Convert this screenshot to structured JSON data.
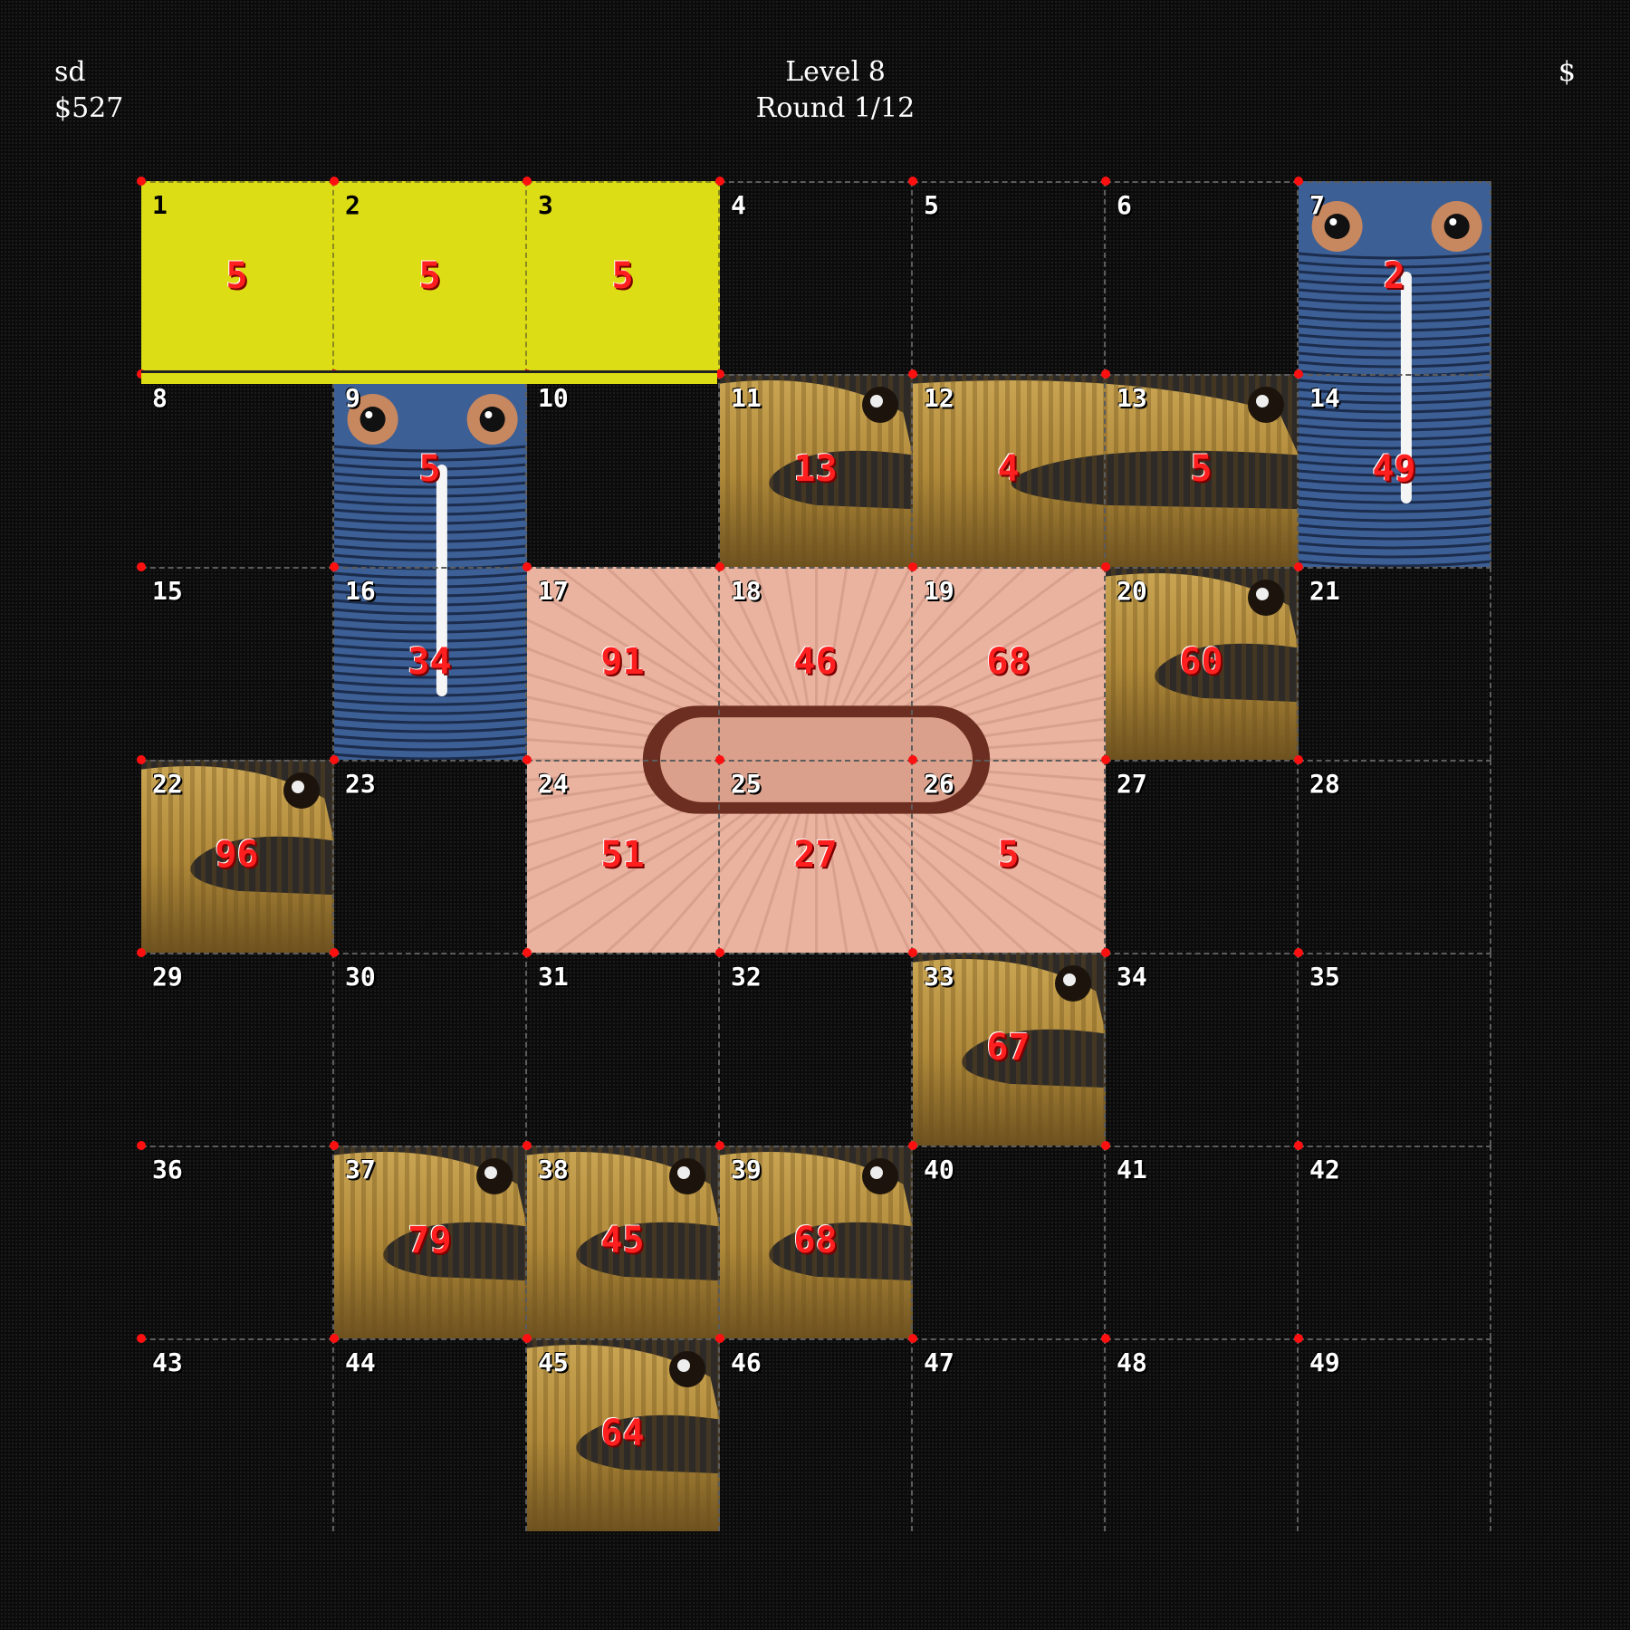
{
  "hud": {
    "player_name": "sd",
    "money": "$527",
    "level": "Level 8",
    "round": "Round 1/12",
    "currency_symbol": "$"
  },
  "board": {
    "cols": 7,
    "rows": 7,
    "cells": [
      {
        "n": "1",
        "v": "5",
        "kind": "yellow"
      },
      {
        "n": "2",
        "v": "5",
        "kind": "yellow"
      },
      {
        "n": "3",
        "v": "5",
        "kind": "yellow"
      },
      {
        "n": "4",
        "v": "",
        "kind": "empty"
      },
      {
        "n": "5",
        "v": "",
        "kind": "empty"
      },
      {
        "n": "6",
        "v": "",
        "kind": "empty"
      },
      {
        "n": "7",
        "v": "2",
        "kind": "blue"
      },
      {
        "n": "8",
        "v": "",
        "kind": "empty"
      },
      {
        "n": "9",
        "v": "5",
        "kind": "blue"
      },
      {
        "n": "10",
        "v": "",
        "kind": "empty"
      },
      {
        "n": "11",
        "v": "13",
        "kind": "worm"
      },
      {
        "n": "12",
        "v": "4",
        "kind": "worm"
      },
      {
        "n": "13",
        "v": "5",
        "kind": "worm"
      },
      {
        "n": "14",
        "v": "49",
        "kind": "blue"
      },
      {
        "n": "15",
        "v": "",
        "kind": "empty"
      },
      {
        "n": "16",
        "v": "34",
        "kind": "blue"
      },
      {
        "n": "17",
        "v": "91",
        "kind": "pink"
      },
      {
        "n": "18",
        "v": "46",
        "kind": "pink"
      },
      {
        "n": "19",
        "v": "68",
        "kind": "pink"
      },
      {
        "n": "20",
        "v": "60",
        "kind": "worm"
      },
      {
        "n": "21",
        "v": "",
        "kind": "empty"
      },
      {
        "n": "22",
        "v": "96",
        "kind": "worm"
      },
      {
        "n": "23",
        "v": "",
        "kind": "empty"
      },
      {
        "n": "24",
        "v": "51",
        "kind": "pink"
      },
      {
        "n": "25",
        "v": "27",
        "kind": "pink"
      },
      {
        "n": "26",
        "v": "5",
        "kind": "pink"
      },
      {
        "n": "27",
        "v": "",
        "kind": "empty"
      },
      {
        "n": "28",
        "v": "",
        "kind": "empty"
      },
      {
        "n": "29",
        "v": "",
        "kind": "empty"
      },
      {
        "n": "30",
        "v": "",
        "kind": "empty"
      },
      {
        "n": "31",
        "v": "",
        "kind": "empty"
      },
      {
        "n": "32",
        "v": "",
        "kind": "empty"
      },
      {
        "n": "33",
        "v": "67",
        "kind": "worm"
      },
      {
        "n": "34",
        "v": "",
        "kind": "empty"
      },
      {
        "n": "35",
        "v": "",
        "kind": "empty"
      },
      {
        "n": "36",
        "v": "",
        "kind": "empty"
      },
      {
        "n": "37",
        "v": "79",
        "kind": "worm"
      },
      {
        "n": "38",
        "v": "45",
        "kind": "worm"
      },
      {
        "n": "39",
        "v": "68",
        "kind": "worm"
      },
      {
        "n": "40",
        "v": "",
        "kind": "empty"
      },
      {
        "n": "41",
        "v": "",
        "kind": "empty"
      },
      {
        "n": "42",
        "v": "",
        "kind": "empty"
      },
      {
        "n": "43",
        "v": "",
        "kind": "empty"
      },
      {
        "n": "44",
        "v": "",
        "kind": "empty"
      },
      {
        "n": "45",
        "v": "64",
        "kind": "worm"
      },
      {
        "n": "46",
        "v": "",
        "kind": "empty"
      },
      {
        "n": "47",
        "v": "",
        "kind": "empty"
      },
      {
        "n": "48",
        "v": "",
        "kind": "empty"
      },
      {
        "n": "49",
        "v": "",
        "kind": "empty"
      }
    ]
  },
  "pieces": [
    {
      "name": "tan-worm-piece",
      "cells": [
        "11"
      ]
    },
    {
      "name": "tan-worm-piece",
      "cells": [
        "12",
        "13"
      ]
    },
    {
      "name": "tan-worm-piece",
      "cells": [
        "20"
      ]
    },
    {
      "name": "tan-worm-piece",
      "cells": [
        "22"
      ]
    },
    {
      "name": "tan-worm-piece",
      "cells": [
        "33"
      ]
    },
    {
      "name": "tan-worm-piece",
      "cells": [
        "37"
      ]
    },
    {
      "name": "tan-worm-piece",
      "cells": [
        "38"
      ]
    },
    {
      "name": "tan-worm-piece",
      "cells": [
        "39"
      ]
    },
    {
      "name": "tan-worm-piece",
      "cells": [
        "45"
      ]
    },
    {
      "name": "blue-worm-piece",
      "cells": [
        "7",
        "14"
      ]
    },
    {
      "name": "blue-worm-piece",
      "cells": [
        "9",
        "16"
      ]
    },
    {
      "name": "pink-worm-piece",
      "cells": [
        "17",
        "18",
        "19",
        "24",
        "25",
        "26"
      ]
    }
  ],
  "colors": {
    "selection": "#dddd15",
    "value_text": "#ff1f1f",
    "grid_dot": "#ff1010",
    "tan_worm": "#b08a3a",
    "blue_worm": "#3c5f95",
    "pink_worm": "#e9b3a0"
  }
}
